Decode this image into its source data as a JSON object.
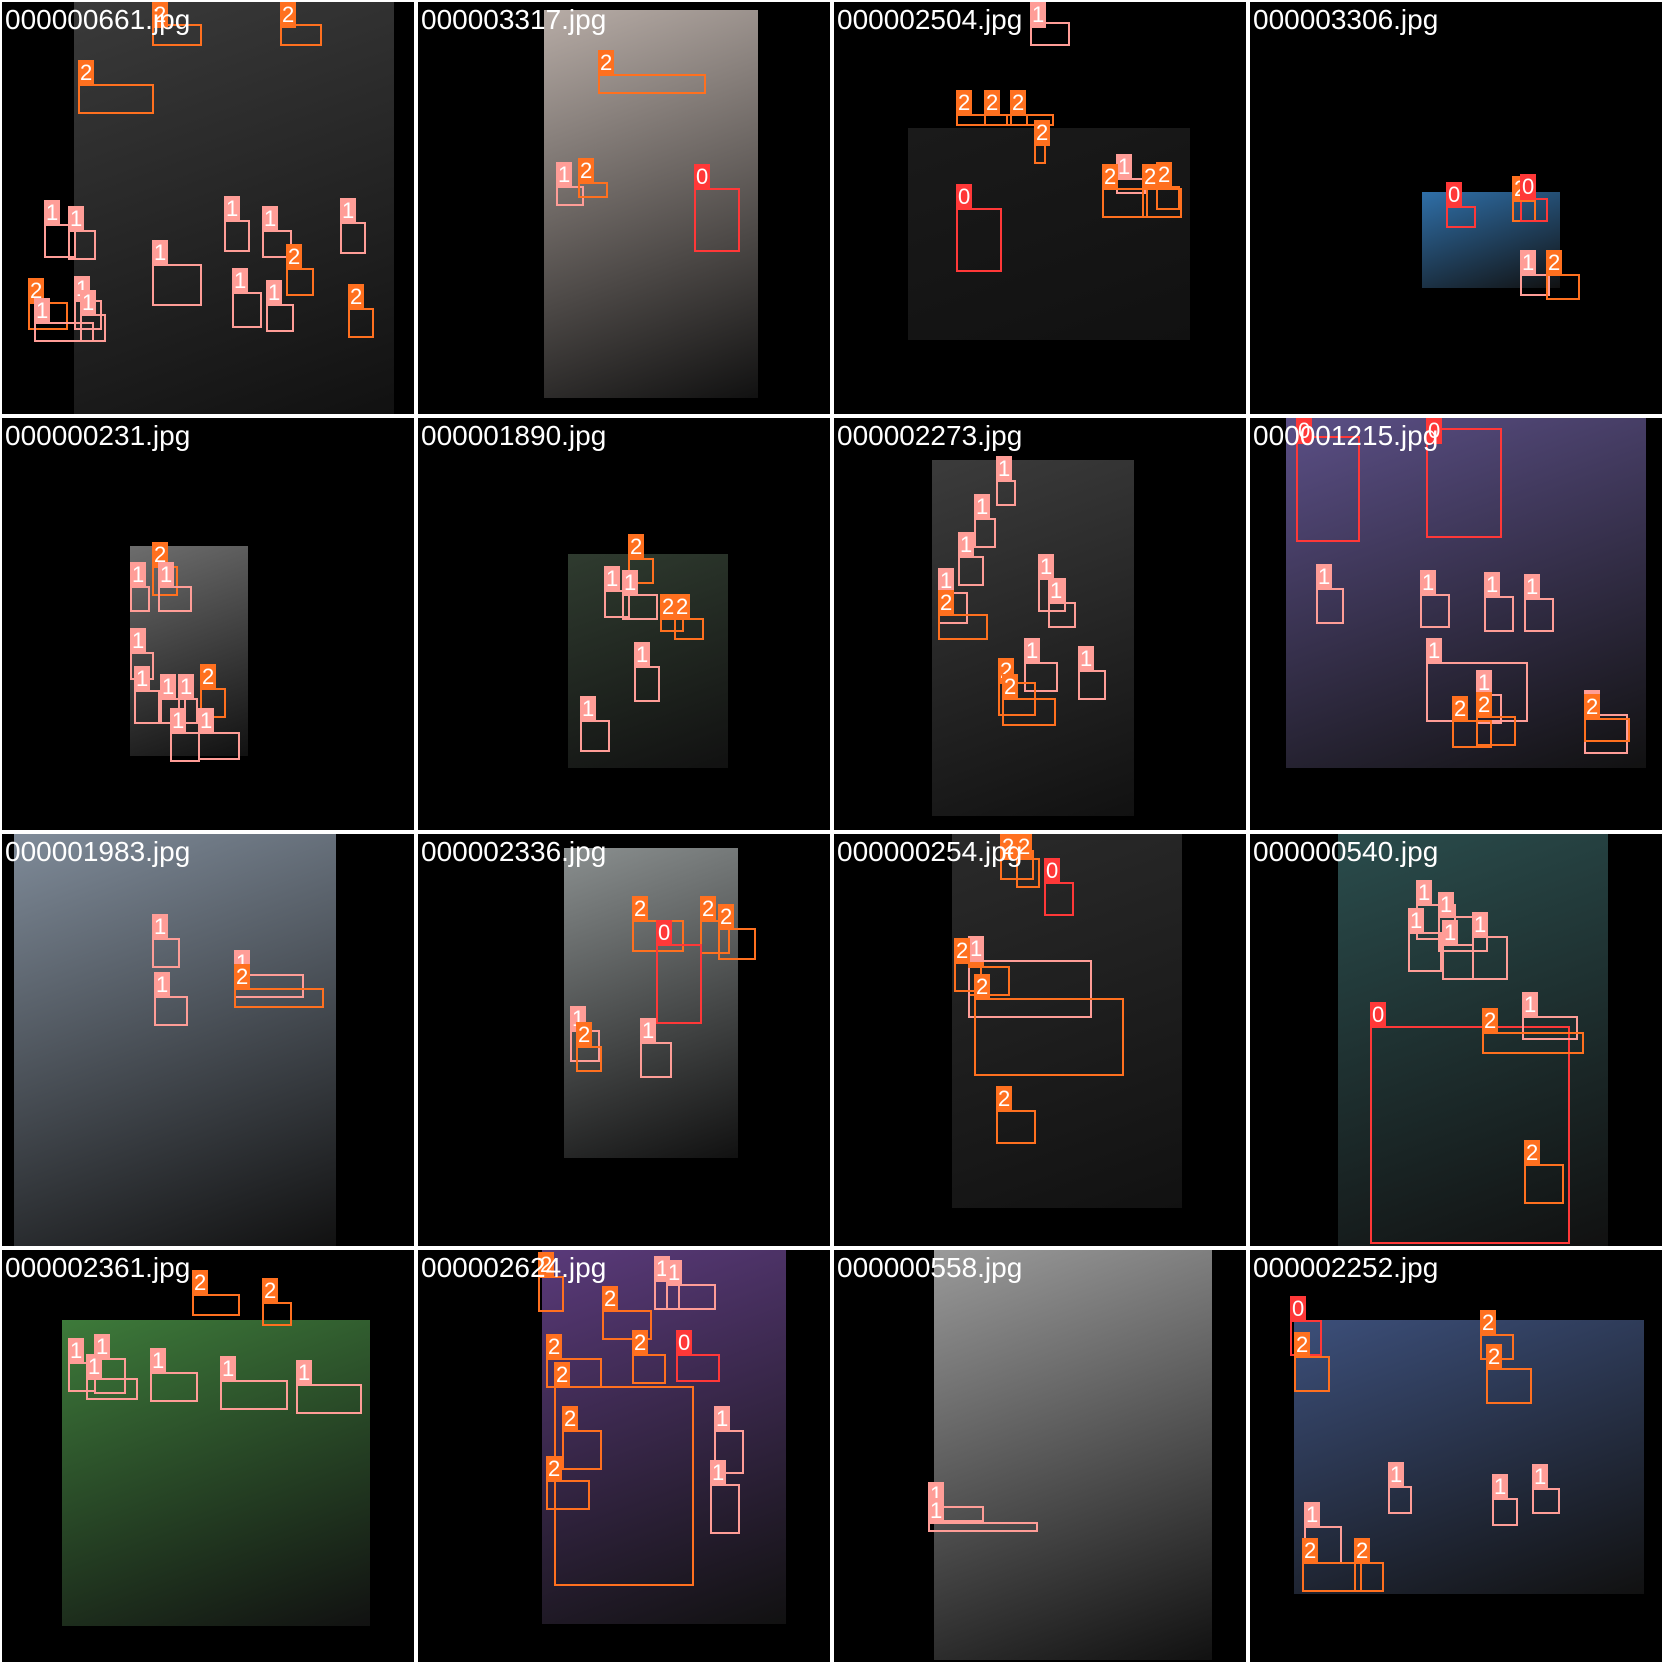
{
  "class_colors": {
    "0": "#ff3838",
    "1": "#ff9d97",
    "2": "#ff701f"
  },
  "tiles": [
    {
      "filename": "000000661.jpg",
      "frame_color": "#3a3a3a",
      "boxes": [
        {
          "cls": "2"
        },
        {
          "cls": "2"
        },
        {
          "cls": "2"
        },
        {
          "cls": "1"
        },
        {
          "cls": "1"
        },
        {
          "cls": "1"
        },
        {
          "cls": "2"
        },
        {
          "cls": "1"
        },
        {
          "cls": "1"
        },
        {
          "cls": "1"
        },
        {
          "cls": "1"
        },
        {
          "cls": "2"
        },
        {
          "cls": "1"
        },
        {
          "cls": "1"
        },
        {
          "cls": "2"
        },
        {
          "cls": "1"
        },
        {
          "cls": "1"
        }
      ]
    },
    {
      "filename": "000003317.jpg",
      "frame_color": "#b7aca6",
      "boxes": [
        {
          "cls": "2"
        },
        {
          "cls": "1"
        },
        {
          "cls": "2"
        },
        {
          "cls": "0"
        }
      ]
    },
    {
      "filename": "000002504.jpg",
      "frame_color": "#1a1a1a",
      "boxes": [
        {
          "cls": "1"
        },
        {
          "cls": "2"
        },
        {
          "cls": "2"
        },
        {
          "cls": "2"
        },
        {
          "cls": "2"
        },
        {
          "cls": "0"
        },
        {
          "cls": "1"
        },
        {
          "cls": "2"
        },
        {
          "cls": "2"
        },
        {
          "cls": "2"
        }
      ]
    },
    {
      "filename": "000003306.jpg",
      "frame_color": "#2f6fa8",
      "boxes": [
        {
          "cls": "0"
        },
        {
          "cls": "2"
        },
        {
          "cls": "0"
        },
        {
          "cls": "1"
        },
        {
          "cls": "2"
        }
      ]
    },
    {
      "filename": "000000231.jpg",
      "frame_color": "#6d6d6d",
      "boxes": [
        {
          "cls": "2"
        },
        {
          "cls": "1"
        },
        {
          "cls": "1"
        },
        {
          "cls": "1"
        },
        {
          "cls": "1"
        },
        {
          "cls": "1"
        },
        {
          "cls": "1"
        },
        {
          "cls": "2"
        },
        {
          "cls": "1"
        },
        {
          "cls": "1"
        }
      ]
    },
    {
      "filename": "000001890.jpg",
      "frame_color": "#2f3b2f",
      "boxes": [
        {
          "cls": "2"
        },
        {
          "cls": "1"
        },
        {
          "cls": "1"
        },
        {
          "cls": "2"
        },
        {
          "cls": "2"
        },
        {
          "cls": "1"
        },
        {
          "cls": "1"
        }
      ]
    },
    {
      "filename": "000002273.jpg",
      "frame_color": "#3b3b3b",
      "boxes": [
        {
          "cls": "1"
        },
        {
          "cls": "1"
        },
        {
          "cls": "1"
        },
        {
          "cls": "1"
        },
        {
          "cls": "2"
        },
        {
          "cls": "1"
        },
        {
          "cls": "1"
        },
        {
          "cls": "1"
        },
        {
          "cls": "2"
        },
        {
          "cls": "2"
        },
        {
          "cls": "1"
        }
      ]
    },
    {
      "filename": "000001215.jpg",
      "frame_color": "#5b4f86",
      "boxes": [
        {
          "cls": "0"
        },
        {
          "cls": "0"
        },
        {
          "cls": "1"
        },
        {
          "cls": "1"
        },
        {
          "cls": "1"
        },
        {
          "cls": "1"
        },
        {
          "cls": "1"
        },
        {
          "cls": "1"
        },
        {
          "cls": "2"
        },
        {
          "cls": "2"
        },
        {
          "cls": "1"
        },
        {
          "cls": "2"
        }
      ]
    },
    {
      "filename": "000001983.jpg",
      "frame_color": "#7f8b99",
      "boxes": [
        {
          "cls": "1"
        },
        {
          "cls": "1"
        },
        {
          "cls": "1"
        },
        {
          "cls": "2"
        }
      ]
    },
    {
      "filename": "000002336.jpg",
      "frame_color": "#8a8f8f",
      "boxes": [
        {
          "cls": "2"
        },
        {
          "cls": "2"
        },
        {
          "cls": "0"
        },
        {
          "cls": "2"
        },
        {
          "cls": "1"
        },
        {
          "cls": "2"
        },
        {
          "cls": "1"
        }
      ]
    },
    {
      "filename": "000000254.jpg",
      "frame_color": "#2a2a2a",
      "boxes": [
        {
          "cls": "2"
        },
        {
          "cls": "2"
        },
        {
          "cls": "0"
        },
        {
          "cls": "2"
        },
        {
          "cls": "1"
        },
        {
          "cls": "2"
        },
        {
          "cls": "2"
        },
        {
          "cls": "2"
        }
      ]
    },
    {
      "filename": "000000540.jpg",
      "frame_color": "#2a4c4c",
      "boxes": [
        {
          "cls": "1"
        },
        {
          "cls": "1"
        },
        {
          "cls": "1"
        },
        {
          "cls": "1"
        },
        {
          "cls": "1"
        },
        {
          "cls": "0"
        },
        {
          "cls": "1"
        },
        {
          "cls": "2"
        },
        {
          "cls": "2"
        }
      ]
    },
    {
      "filename": "000002361.jpg",
      "frame_color": "#3d7a3a",
      "boxes": [
        {
          "cls": "2"
        },
        {
          "cls": "2"
        },
        {
          "cls": "1"
        },
        {
          "cls": "1"
        },
        {
          "cls": "1"
        },
        {
          "cls": "1"
        },
        {
          "cls": "1"
        },
        {
          "cls": "1"
        }
      ]
    },
    {
      "filename": "000002624.jpg",
      "frame_color": "#5a3a7a",
      "boxes": [
        {
          "cls": "2"
        },
        {
          "cls": "1"
        },
        {
          "cls": "1"
        },
        {
          "cls": "2"
        },
        {
          "cls": "2"
        },
        {
          "cls": "0"
        },
        {
          "cls": "2"
        },
        {
          "cls": "2"
        },
        {
          "cls": "2"
        },
        {
          "cls": "2"
        },
        {
          "cls": "1"
        },
        {
          "cls": "1"
        }
      ]
    },
    {
      "filename": "000000558.jpg",
      "frame_color": "#9a9a9a",
      "boxes": [
        {
          "cls": "1"
        },
        {
          "cls": "1"
        }
      ]
    },
    {
      "filename": "000002252.jpg",
      "frame_color": "#3c4f7a",
      "boxes": [
        {
          "cls": "0"
        },
        {
          "cls": "2"
        },
        {
          "cls": "2"
        },
        {
          "cls": "2"
        },
        {
          "cls": "1"
        },
        {
          "cls": "1"
        },
        {
          "cls": "1"
        },
        {
          "cls": "1"
        },
        {
          "cls": "2"
        },
        {
          "cls": "2"
        }
      ]
    }
  ]
}
